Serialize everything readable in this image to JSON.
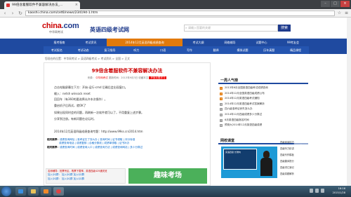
{
  "browser": {
    "tab_title": "99倍含着服软件不兼容解决办法_...",
    "tab_close": "×",
    "url": "kaoshi.china.com/cet6/news/234194-1.htm",
    "window_buttons": [
      "–",
      "□",
      "×"
    ],
    "nav": {
      "back": "‹",
      "forward": "›",
      "reload": "↻"
    },
    "star": "☆",
    "menu": "≡"
  },
  "site": {
    "logo_text": "china",
    "logo_tld": ".com",
    "logo_sub": "中华网考试",
    "name": "英语四级考试网",
    "search_placeholder": "请输入您要的关键",
    "search_button": "搜索"
  },
  "nav_row1": [
    "报考指南",
    "考试资讯",
    "2014年12月英语四级成绩查询",
    "考试大纲",
    "网络辅导",
    "试题中心",
    "99考友会"
  ],
  "nav_row2": [
    "考试报名",
    "考试动态",
    "复习指导",
    "听力",
    "口语",
    "写作",
    "翻译",
    "模拟试题",
    "历年真题",
    "精品课程"
  ],
  "nav_active": 2,
  "breadcrumb": "您现在的位置：中华网考试 > 英语四级考试 > 考试资讯 > 全国 > 正文",
  "article": {
    "title": "99倍含着服软件不兼容解决办法",
    "meta_source": "来源：",
    "meta_source_value": "中华网考试",
    "meta_date": "更新时间：2013年9月3日",
    "meta_fav": "收藏本文",
    "meta_btn": "开放无限学习",
    "paragraphs": [
      "点击电脑屏幕左下方：开始-运行-cmd 后确后会出现窗口。",
      "输入：netsh winsock reset",
      "回回车（有360的要选择允许本次操作）。",
      "重启机子后再试，就OK了",
      "如果出现同时会的问题，再刷新一次软件就可以了，不用重复上述步骤。",
      "分享到注册。有新问题在论坛时。"
    ],
    "link_line": "2014年12月英语四级成绩查询专题：http://www.99ks.cn/2014.htm",
    "related": [
      {
        "k": "相关推荐：",
        "v": "成绩查询网址 | 准考证忘了怎么办 | 查询时间 | 证书领取 | 评分标准"
      },
      {
        "k": "",
        "v": "成绩查询电话 | 成绩复核 | 合格分数线 | 成绩单领取 | 证书补办"
      },
      {
        "k": "相关推荐：",
        "v": "成绩查询时间 | 成绩查询入口 | 成绩查询方法 | 成绩查询网站 | 多少分算过"
      }
    ],
    "qq_line1": "名师辅导：抢票专区，购票下载率，英语四级425通关班",
    "qq_line2": "加入QQ群： 加入QQ群 加入QQ群",
    "qq_line3": "加入QQ群： 加入QQ群 加入QQ群",
    "ad_text": "趣味考场"
  },
  "sidebar": {
    "hot_title": "一周人气榜",
    "hot_items": [
      "2013年6月全国英语四级考试成绩查询",
      "2014年12月全国英语四级成绩公布",
      "2014年12月英语四级考试通知",
      "2014年12月英语四级考试答案解析",
      "四六级准考证丢失怎么办",
      "2014年12月四级成绩多少分算过",
      "6月英语四级报名时间",
      "预测大2014年12月英语四级成绩"
    ],
    "video_title": "网校课堂",
    "video_board": "英语四级 长难句",
    "video_list": [
      "四级阅读技巧",
      "四级听力精讲",
      "四级写作模板",
      "四级翻译提分",
      "四级词汇速记",
      "四级真题解析"
    ]
  },
  "watermark": "下载吧",
  "taskbar": {
    "clock_time": "16:16",
    "clock_date": "2015/1/28"
  }
}
